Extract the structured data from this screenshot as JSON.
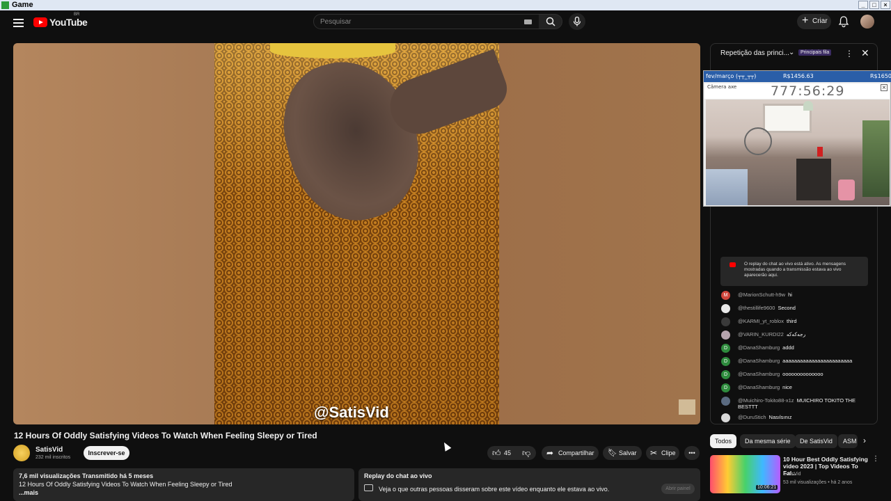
{
  "window": {
    "title": "Game"
  },
  "header": {
    "logo_text": "YouTube",
    "region": "BR",
    "search_placeholder": "Pesquisar",
    "create_label": "Criar"
  },
  "video": {
    "watermark": "@SatisVid",
    "title": "12 Hours Of Oddly Satisfying Videos To Watch When Feeling Sleepy or Tired",
    "channel_name": "SatisVid",
    "subscribers": "232 mil inscritos",
    "subscribe_label": "Inscrever-se",
    "likes": "45",
    "share_label": "Compartilhar",
    "save_label": "Salvar",
    "clip_label": "Clipe"
  },
  "description": {
    "stats": "7,6 mil visualizações  Transmitido há 5 meses",
    "text": "12 Hours Of Oddly Satisfying Videos To Watch When Feeling Sleepy or Tired",
    "more": "...mais"
  },
  "replay": {
    "heading": "Replay do chat ao vivo",
    "text": "Veja o que outras pessoas disseram sobre este vídeo enquanto ele estava ao vivo.",
    "open_label": "Abrir painel"
  },
  "chat": {
    "title": "Repetição das princi...",
    "badge": "Principais fila",
    "notice": "O replay do chat ao vivo está ativo. As mensagens mostradas quando a transmissão estava ao vivo aparecerão aqui.",
    "messages": [
      {
        "author": "@MarionSchutt-h9w",
        "text": "hi",
        "avatar": "M",
        "color": "#d0453b"
      },
      {
        "author": "@thestillife9600",
        "text": "Second",
        "avatar": "",
        "color": "#e8e8e8"
      },
      {
        "author": "@KARMI_yt_roblox",
        "text": "third",
        "avatar": "",
        "color": "#3a3a3a"
      },
      {
        "author": "@VARIN_KURDI22",
        "text": "رجەکەکە",
        "avatar": "",
        "color": "#b5a3ad"
      },
      {
        "author": "@DanaShamburg",
        "text": "addd",
        "avatar": "D",
        "color": "#2e8b3d"
      },
      {
        "author": "@DanaShamburg",
        "text": "aaaaaaaaaaaaaaaaaaaaaaaa",
        "avatar": "D",
        "color": "#2e8b3d"
      },
      {
        "author": "@DanaShamburg",
        "text": "oooooooooooooo",
        "avatar": "D",
        "color": "#2e8b3d"
      },
      {
        "author": "@DanaShamburg",
        "text": "nice",
        "avatar": "D",
        "color": "#2e8b3d"
      },
      {
        "author": "@Muichiro-Tokito88-x1z",
        "text": "MUICHIRO TOKITO THE BESTTT",
        "avatar": "",
        "color": "#5a6a80"
      },
      {
        "author": "@DuruStich",
        "text": "Nasılsınız",
        "avatar": "",
        "color": "#d8d8d8"
      }
    ]
  },
  "overlay": {
    "label_left": "fev/março (┬┬_┬┬)",
    "amount_mid": "R$1456.63",
    "amount_right": "R$1650",
    "camera_label": "Câmera axe",
    "timer": "777:56:29"
  },
  "recommendations": {
    "tabs": [
      "Todos",
      "Da mesma série",
      "De SatisVid",
      "ASM"
    ],
    "items": [
      {
        "title": "10 Hour Best Oddly Satisfying video 2023 | Top Videos To Fal...",
        "channel": "SatisVid",
        "meta": "53 mil visualizações • há 2 anos",
        "duration": "10:06:21"
      }
    ]
  },
  "colors": {
    "accent_red": "#ff0000",
    "bg": "#0f0f0f",
    "surface": "#272727"
  }
}
